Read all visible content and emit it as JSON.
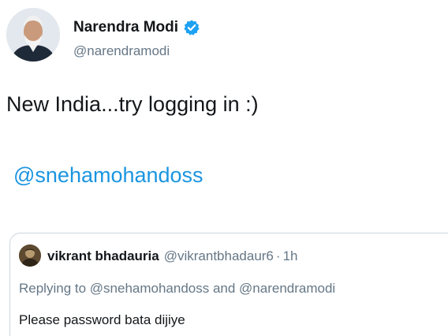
{
  "tweet": {
    "author": {
      "name": "Narendra Modi",
      "handle": "@narendramodi",
      "verified": true,
      "avatar_icon": "profile-photo"
    },
    "text": "New India...try logging in :)",
    "mention": "@snehamohandoss"
  },
  "quoted_reply": {
    "author_name": "vikrant bhadauria",
    "author_handle": "@vikrantbhadaur6",
    "separator": "·",
    "time": "1h",
    "replying_to": "Replying to @snehamohandoss and @narendramodi",
    "text": "Please password bata dijiye"
  },
  "colors": {
    "link": "#1b95e0",
    "muted": "#657786",
    "text": "#14171a",
    "verified": "#1da1f2",
    "border": "#ccd6dd"
  }
}
